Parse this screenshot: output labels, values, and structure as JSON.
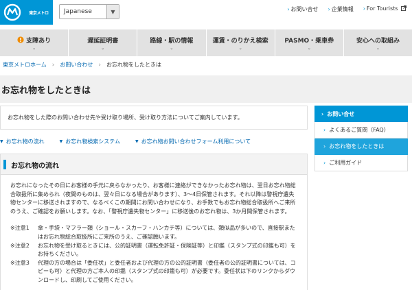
{
  "header": {
    "logo_text": "東京メトロ",
    "language_value": "Japanese",
    "links": [
      {
        "label": "お問い合せ"
      },
      {
        "label": "企業情報"
      },
      {
        "label": "For Tourists"
      }
    ]
  },
  "nav": {
    "items": [
      {
        "label": "支障あり"
      },
      {
        "label": "遅延証明書"
      },
      {
        "label": "路線・駅の情報"
      },
      {
        "label": "運賃・のりかえ検索"
      },
      {
        "label": "PASMO・乗車券"
      },
      {
        "label": "安心への取組み"
      }
    ]
  },
  "breadcrumb": [
    "東京メトロホーム",
    "お問い合わせ",
    "お忘れ物をしたときは"
  ],
  "page": {
    "title": "お忘れ物をしたときは",
    "intro": "お忘れ物をした際のお問い合わせ先や受け取り場所、受け取り方法についてご案内しています。"
  },
  "anchors": [
    "お忘れ物の流れ",
    "お忘れ物検索システム",
    "お忘れ物お問い合わせフォーム利用について"
  ],
  "section": {
    "title": "お忘れ物の流れ",
    "paragraph": "お忘れになったその日にお客様の手元に戻らなかったり、お客様に連絡ができなかったお忘れ物は、翌日お忘れ物総合取扱所に集められ（夜間のものは、翌々日になる場合があります）、3～4日保管されます。それ以降は警視庁遺失物センターに移送されますので、なるべくこの期間にお問い合わせになり、お手数でもお忘れ物総合取扱所へご来所のうえ、ご確認をお願いします。なお、「警視庁遺失物センター」に移送後のお忘れ物は、3か月間保管されます。",
    "notes": [
      {
        "label": "※注意1",
        "text": "傘・手袋・マフラー類（ショール・スカーフ・ハンカチ等）については、類似品が多いので、直接駅またはお忘れ物総合取扱所にご来所のうえ、ご確認願います。"
      },
      {
        "label": "※注意2",
        "text": "お忘れ物を受け取るときには、公的証明書（運転免許証・保険証等）と印鑑（スタンプ式の印鑑も可）をお持ちください。"
      },
      {
        "label": "※注意3",
        "text": "代理の方の場合は「委任状」と委任者および代理の方の公的証明書（委任者の公的証明書については、コピーも可）と代理の方ご本人の印鑑（スタンプ式の印鑑も可）が必要です。委任状は下のリンクからダウンロードし、印刷してご使用ください。"
      }
    ]
  },
  "sidebar": {
    "heading": "お問い合せ",
    "items": [
      {
        "label": "よくあるご質問（FAQ）"
      },
      {
        "label": "お忘れ物をしたときは"
      },
      {
        "label": "ご利用ガイド"
      }
    ]
  },
  "colors": {
    "accent": "#0096d6",
    "nav_bg": "#e2e2e2",
    "alert": "#f08c00"
  }
}
